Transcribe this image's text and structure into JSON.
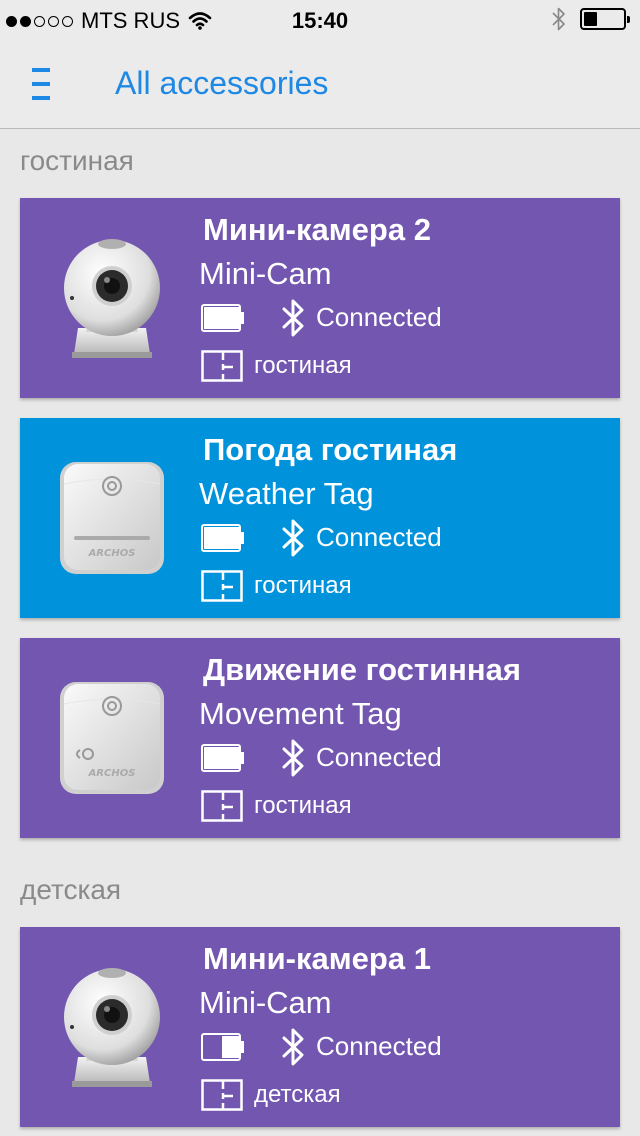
{
  "status_bar": {
    "carrier": "MTS RUS",
    "time": "15:40",
    "signal_bars_filled": 2,
    "signal_bars_total": 5,
    "battery_level": 0.35
  },
  "nav": {
    "title": "All accessories",
    "menu_icon": "hamburger-menu-icon"
  },
  "colors": {
    "purple": "#7256b0",
    "blue": "#0093dc",
    "accent": "#1e88e5"
  },
  "sections": [
    {
      "title": "гостиная",
      "cards": [
        {
          "name": "Мини-камера 2",
          "type": "Mini-Cam",
          "status": "Connected",
          "room": "гостиная",
          "device": "mini-cam",
          "color": "purple",
          "battery_level": 1.0
        },
        {
          "name": "Погода гостиная",
          "type": "Weather Tag",
          "status": "Connected",
          "room": "гостиная",
          "device": "weather-tag",
          "color": "blue",
          "battery_level": 1.0
        },
        {
          "name": "Движение гостинная",
          "type": "Movement Tag",
          "status": "Connected",
          "room": "гостиная",
          "device": "movement-tag",
          "color": "purple",
          "battery_level": 1.0
        }
      ]
    },
    {
      "title": "детская",
      "cards": [
        {
          "name": "Мини-камера 1",
          "type": "Mini-Cam",
          "status": "Connected",
          "room": "детская",
          "device": "mini-cam",
          "color": "purple",
          "battery_level": 0.5
        }
      ]
    }
  ]
}
